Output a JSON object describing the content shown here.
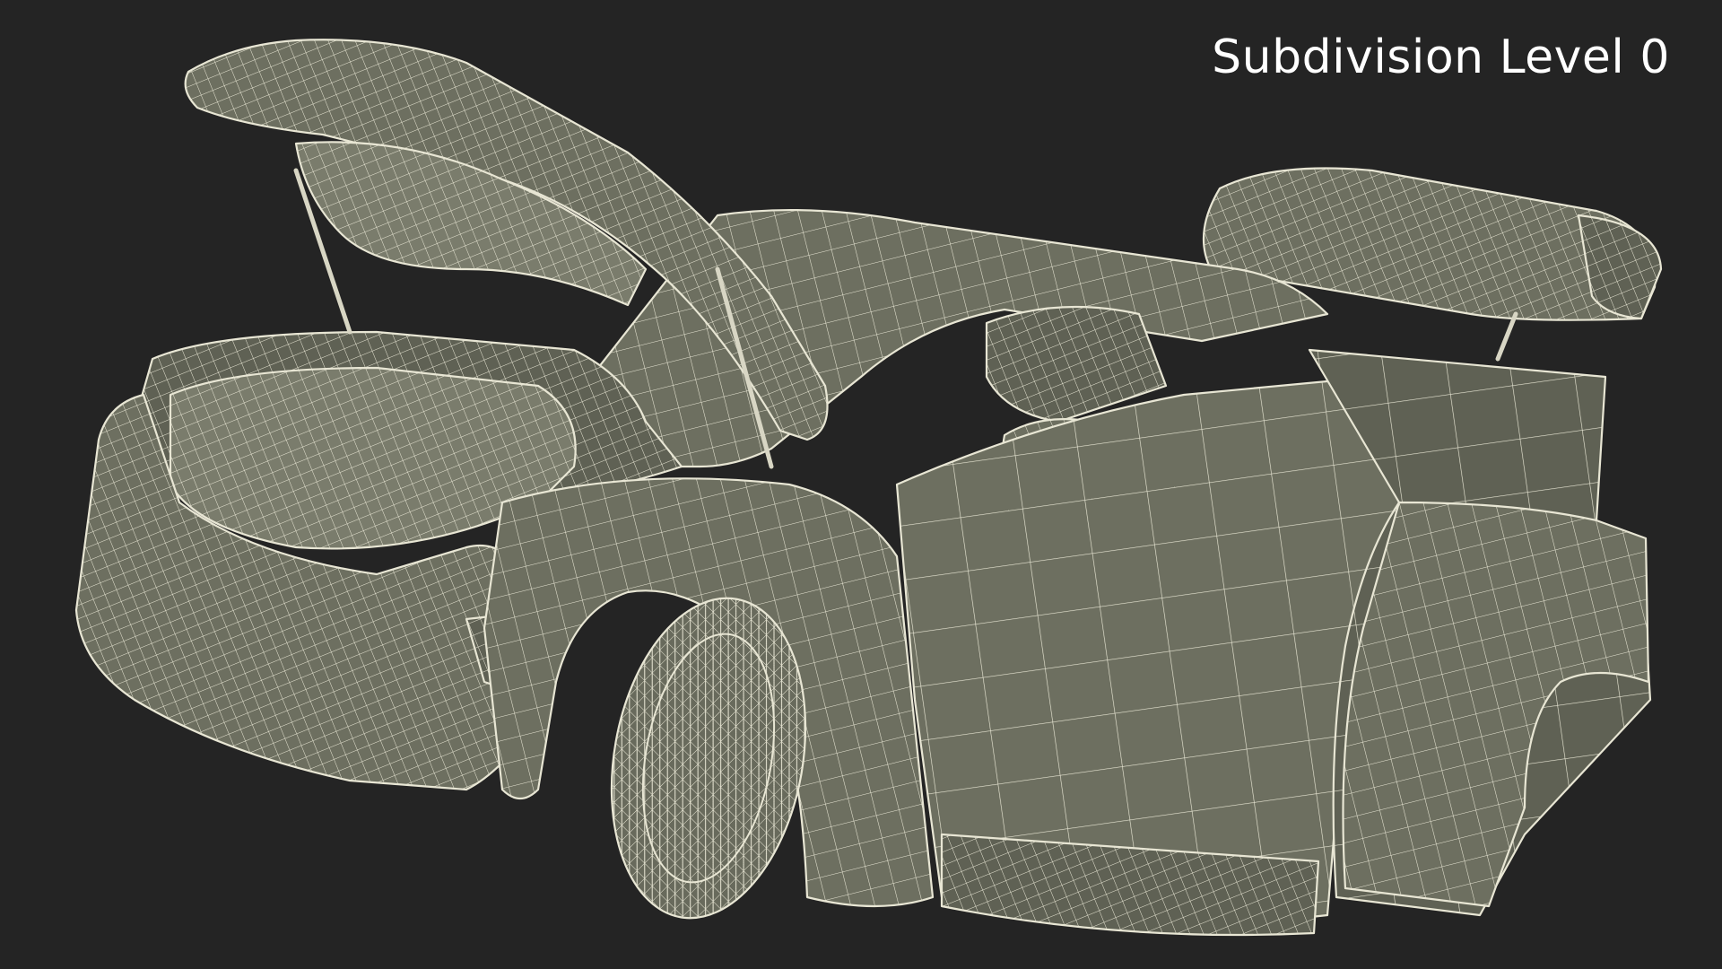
{
  "viewport": {
    "label": "Subdivision Level 0",
    "background_color": "#242424",
    "mesh_fill_color": "#6d6f60",
    "wire_color": "#e8e6d4",
    "label_color": "#ffffff"
  }
}
